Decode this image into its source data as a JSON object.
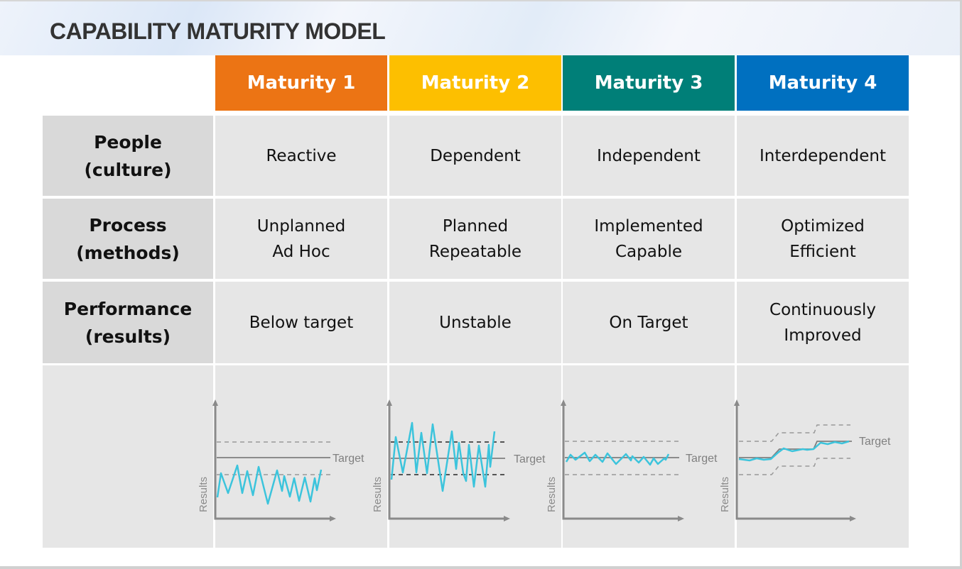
{
  "title": "CAPABILITY MATURITY MODEL",
  "columns": [
    {
      "label": "Maturity 1",
      "color": "#EC7414"
    },
    {
      "label": "Maturity 2",
      "color": "#FDBF00"
    },
    {
      "label": "Maturity 3",
      "color": "#007F78"
    },
    {
      "label": "Maturity 4",
      "color": "#0070C0"
    }
  ],
  "rows": [
    {
      "label_1": "People",
      "label_2": "(culture)",
      "cells": [
        [
          "Reactive"
        ],
        [
          "Dependent"
        ],
        [
          "Independent"
        ],
        [
          "Interdependent"
        ]
      ]
    },
    {
      "label_1": "Process",
      "label_2": "(methods)",
      "cells": [
        [
          "Unplanned",
          "Ad Hoc"
        ],
        [
          "Planned",
          "Repeatable"
        ],
        [
          "Implemented",
          "Capable"
        ],
        [
          "Optimized",
          "Efficient"
        ]
      ]
    },
    {
      "label_1": "Performance",
      "label_2": "(results)",
      "cells": [
        [
          "Below target"
        ],
        [
          "Unstable"
        ],
        [
          "On Target"
        ],
        [
          "Continuously",
          "Improved"
        ]
      ]
    }
  ],
  "charts": {
    "target_label": "Target",
    "y_axis_label": "Results",
    "result_line_color": "#3CC4DC",
    "target_line_color": "#7f7f7f"
  }
}
